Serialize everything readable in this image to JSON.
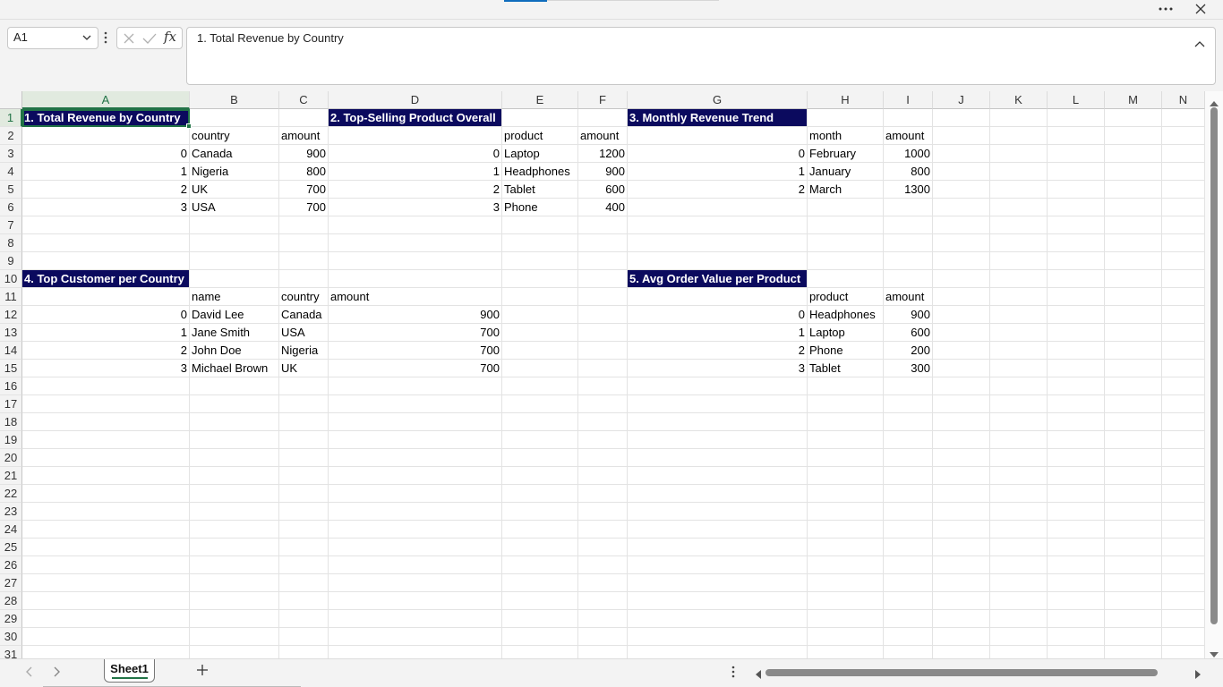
{
  "name_box": "A1",
  "formula": "1. Total Revenue by Country",
  "columns": [
    {
      "label": "A",
      "w": 187,
      "selected": true
    },
    {
      "label": "B",
      "w": 100
    },
    {
      "label": "C",
      "w": 55
    },
    {
      "label": "D",
      "w": 194
    },
    {
      "label": "E",
      "w": 85
    },
    {
      "label": "F",
      "w": 55
    },
    {
      "label": "G",
      "w": 201
    },
    {
      "label": "H",
      "w": 85
    },
    {
      "label": "I",
      "w": 55
    },
    {
      "label": "J",
      "w": 64
    },
    {
      "label": "K",
      "w": 64
    },
    {
      "label": "L",
      "w": 64
    },
    {
      "label": "M",
      "w": 64
    },
    {
      "label": "N",
      "w": 64
    }
  ],
  "rows": [
    "1",
    "2",
    "3",
    "4",
    "5",
    "6",
    "7",
    "8",
    "9",
    "10",
    "11",
    "12",
    "13",
    "14",
    "15",
    "16",
    "17",
    "18",
    "19",
    "20",
    "21",
    "22",
    "23",
    "24",
    "25",
    "26",
    "27",
    "28",
    "29",
    "30",
    "31"
  ],
  "cells": [
    {
      "r": 1,
      "c": 0,
      "v": "1. Total Revenue by Country",
      "title": true,
      "active": true
    },
    {
      "r": 1,
      "c": 3,
      "v": "2. Top-Selling Product Overall",
      "title": true
    },
    {
      "r": 1,
      "c": 6,
      "v": "3. Monthly Revenue Trend",
      "title": true
    },
    {
      "r": 2,
      "c": 1,
      "v": "country"
    },
    {
      "r": 2,
      "c": 2,
      "v": "amount"
    },
    {
      "r": 2,
      "c": 4,
      "v": "product"
    },
    {
      "r": 2,
      "c": 5,
      "v": "amount"
    },
    {
      "r": 2,
      "c": 7,
      "v": "month"
    },
    {
      "r": 2,
      "c": 8,
      "v": "amount"
    },
    {
      "r": 3,
      "c": 0,
      "v": "0",
      "num": true
    },
    {
      "r": 3,
      "c": 1,
      "v": "Canada"
    },
    {
      "r": 3,
      "c": 2,
      "v": "900",
      "num": true
    },
    {
      "r": 3,
      "c": 3,
      "v": "0",
      "num": true
    },
    {
      "r": 3,
      "c": 4,
      "v": "Laptop"
    },
    {
      "r": 3,
      "c": 5,
      "v": "1200",
      "num": true
    },
    {
      "r": 3,
      "c": 6,
      "v": "0",
      "num": true
    },
    {
      "r": 3,
      "c": 7,
      "v": "February"
    },
    {
      "r": 3,
      "c": 8,
      "v": "1000",
      "num": true
    },
    {
      "r": 4,
      "c": 0,
      "v": "1",
      "num": true
    },
    {
      "r": 4,
      "c": 1,
      "v": "Nigeria"
    },
    {
      "r": 4,
      "c": 2,
      "v": "800",
      "num": true
    },
    {
      "r": 4,
      "c": 3,
      "v": "1",
      "num": true
    },
    {
      "r": 4,
      "c": 4,
      "v": "Headphones"
    },
    {
      "r": 4,
      "c": 5,
      "v": "900",
      "num": true
    },
    {
      "r": 4,
      "c": 6,
      "v": "1",
      "num": true
    },
    {
      "r": 4,
      "c": 7,
      "v": "January"
    },
    {
      "r": 4,
      "c": 8,
      "v": "800",
      "num": true
    },
    {
      "r": 5,
      "c": 0,
      "v": "2",
      "num": true
    },
    {
      "r": 5,
      "c": 1,
      "v": "UK"
    },
    {
      "r": 5,
      "c": 2,
      "v": "700",
      "num": true
    },
    {
      "r": 5,
      "c": 3,
      "v": "2",
      "num": true
    },
    {
      "r": 5,
      "c": 4,
      "v": "Tablet"
    },
    {
      "r": 5,
      "c": 5,
      "v": "600",
      "num": true
    },
    {
      "r": 5,
      "c": 6,
      "v": "2",
      "num": true
    },
    {
      "r": 5,
      "c": 7,
      "v": "March"
    },
    {
      "r": 5,
      "c": 8,
      "v": "1300",
      "num": true
    },
    {
      "r": 6,
      "c": 0,
      "v": "3",
      "num": true
    },
    {
      "r": 6,
      "c": 1,
      "v": "USA"
    },
    {
      "r": 6,
      "c": 2,
      "v": "700",
      "num": true
    },
    {
      "r": 6,
      "c": 3,
      "v": "3",
      "num": true
    },
    {
      "r": 6,
      "c": 4,
      "v": "Phone"
    },
    {
      "r": 6,
      "c": 5,
      "v": "400",
      "num": true
    },
    {
      "r": 10,
      "c": 0,
      "v": "4. Top Customer per Country",
      "title": true
    },
    {
      "r": 10,
      "c": 6,
      "v": "5. Avg Order Value per Product",
      "title": true
    },
    {
      "r": 11,
      "c": 1,
      "v": "name"
    },
    {
      "r": 11,
      "c": 2,
      "v": "country"
    },
    {
      "r": 11,
      "c": 3,
      "v": "amount"
    },
    {
      "r": 11,
      "c": 7,
      "v": "product"
    },
    {
      "r": 11,
      "c": 8,
      "v": "amount"
    },
    {
      "r": 12,
      "c": 0,
      "v": "0",
      "num": true
    },
    {
      "r": 12,
      "c": 1,
      "v": "David Lee"
    },
    {
      "r": 12,
      "c": 2,
      "v": "Canada"
    },
    {
      "r": 12,
      "c": 3,
      "v": "900",
      "num": true
    },
    {
      "r": 12,
      "c": 6,
      "v": "0",
      "num": true
    },
    {
      "r": 12,
      "c": 7,
      "v": "Headphones"
    },
    {
      "r": 12,
      "c": 8,
      "v": "900",
      "num": true
    },
    {
      "r": 13,
      "c": 0,
      "v": "1",
      "num": true
    },
    {
      "r": 13,
      "c": 1,
      "v": "Jane Smith"
    },
    {
      "r": 13,
      "c": 2,
      "v": "USA"
    },
    {
      "r": 13,
      "c": 3,
      "v": "700",
      "num": true
    },
    {
      "r": 13,
      "c": 6,
      "v": "1",
      "num": true
    },
    {
      "r": 13,
      "c": 7,
      "v": "Laptop"
    },
    {
      "r": 13,
      "c": 8,
      "v": "600",
      "num": true
    },
    {
      "r": 14,
      "c": 0,
      "v": "2",
      "num": true
    },
    {
      "r": 14,
      "c": 1,
      "v": "John Doe"
    },
    {
      "r": 14,
      "c": 2,
      "v": "Nigeria"
    },
    {
      "r": 14,
      "c": 3,
      "v": "700",
      "num": true
    },
    {
      "r": 14,
      "c": 6,
      "v": "2",
      "num": true
    },
    {
      "r": 14,
      "c": 7,
      "v": "Phone"
    },
    {
      "r": 14,
      "c": 8,
      "v": "200",
      "num": true
    },
    {
      "r": 15,
      "c": 0,
      "v": "3",
      "num": true
    },
    {
      "r": 15,
      "c": 1,
      "v": "Michael Brown"
    },
    {
      "r": 15,
      "c": 2,
      "v": "UK"
    },
    {
      "r": 15,
      "c": 3,
      "v": "700",
      "num": true
    },
    {
      "r": 15,
      "c": 6,
      "v": "3",
      "num": true
    },
    {
      "r": 15,
      "c": 7,
      "v": "Tablet"
    },
    {
      "r": 15,
      "c": 8,
      "v": "300",
      "num": true
    }
  ],
  "sheet_tab": "Sheet1",
  "icons": {
    "more": "more-options-icon",
    "close": "close-icon",
    "cancel": "cancel-x-icon",
    "enter": "checkmark-icon",
    "function": "function-fx-icon",
    "add_sheet": "plus-icon"
  },
  "colors": {
    "title_fill": "#0b0a5e",
    "title_text": "#ffffff",
    "accent": "#217346"
  }
}
